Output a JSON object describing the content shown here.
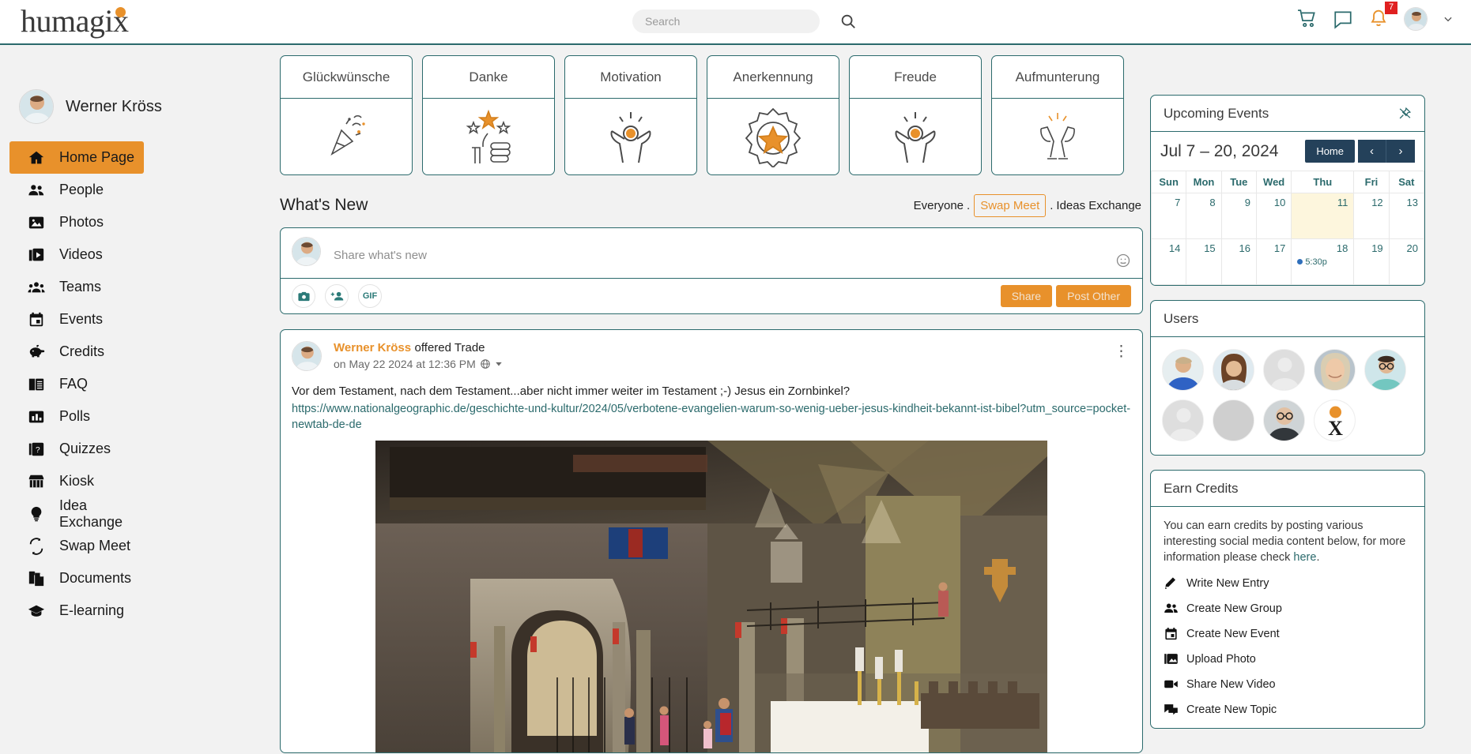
{
  "header": {
    "logo": "humagix",
    "search": {
      "placeholder": "Search",
      "value": ""
    },
    "icons": {
      "cart": "shopping-cart-icon",
      "chat": "chat-bubble-icon",
      "bell": "notification-bell-icon",
      "bell_badge": "7",
      "avatar": "user-avatar",
      "chevron": "chevron-down-icon"
    }
  },
  "sidebar": {
    "user": {
      "name": "Werner Kröss"
    },
    "items": [
      {
        "label": "Home Page",
        "icon": "home-icon",
        "active": true
      },
      {
        "label": "People",
        "icon": "people-icon",
        "active": false
      },
      {
        "label": "Photos",
        "icon": "photo-icon",
        "active": false
      },
      {
        "label": "Videos",
        "icon": "video-icon",
        "active": false
      },
      {
        "label": "Teams",
        "icon": "teams-icon",
        "active": false
      },
      {
        "label": "Events",
        "icon": "calendar-icon",
        "active": false
      },
      {
        "label": "Credits",
        "icon": "piggy-bank-icon",
        "active": false
      },
      {
        "label": "FAQ",
        "icon": "book-icon",
        "active": false
      },
      {
        "label": "Polls",
        "icon": "poll-chart-icon",
        "active": false
      },
      {
        "label": "Quizzes",
        "icon": "quiz-question-icon",
        "active": false
      },
      {
        "label": "Kiosk",
        "icon": "storefront-icon",
        "active": false
      },
      {
        "label": "Idea Exchange",
        "icon": "lightbulb-icon",
        "active": false
      },
      {
        "label": "Swap Meet",
        "icon": "swap-arrows-icon",
        "active": false
      },
      {
        "label": "Documents",
        "icon": "documents-icon",
        "active": false
      },
      {
        "label": "E-learning",
        "icon": "graduation-cap-icon",
        "active": false
      }
    ]
  },
  "recognition_cards": [
    {
      "title": "Glückwünsche",
      "icon": "party-popper-icon"
    },
    {
      "title": "Danke",
      "icon": "thumbs-up-stars-icon"
    },
    {
      "title": "Motivation",
      "icon": "raised-hands-icon"
    },
    {
      "title": "Anerkennung",
      "icon": "award-badge-star-icon"
    },
    {
      "title": "Freude",
      "icon": "celebrate-person-icon"
    },
    {
      "title": "Aufmunterung",
      "icon": "champagne-toast-icon"
    }
  ],
  "feed": {
    "title": "What's New",
    "filters": [
      {
        "label": "Everyone",
        "active": false
      },
      {
        "label": "Swap Meet",
        "active": true
      },
      {
        "label": "Ideas Exchange",
        "active": false
      }
    ],
    "separator": ".",
    "composer": {
      "placeholder": "Share what's new",
      "value": "",
      "tools": [
        "camera-icon",
        "tag-person-icon",
        "gif-icon"
      ],
      "emoji_icon": "emoji-smiley-icon",
      "share_label": "Share",
      "post_other_label": "Post Other"
    },
    "post": {
      "author": "Werner Kröss",
      "action": "offered Trade",
      "date": "on May 22 2024 at 12:36 PM",
      "visibility_icon": "globe-icon",
      "visibility_chevron": "chevron-down-icon",
      "menu_icon": "vertical-ellipsis-icon",
      "text": "Vor dem Testament, nach dem Testament...aber nicht immer weiter im Testament ;-) Jesus ein Zornbinkel?",
      "link": "https://www.nationalgeographic.de/geschichte-und-kultur/2024/05/verbotene-evangelien-warum-so-wenig-ueber-jesus-kindheit-bekannt-ist-bibel?utm_source=pocket-newtab-de-de",
      "image_alt": "church-interior-photo"
    }
  },
  "events_panel": {
    "title": "Upcoming Events",
    "pin_icon": "unpin-icon",
    "range": "Jul 7 – 20, 2024",
    "home_label": "Home",
    "prev_label": "‹",
    "next_label": "›",
    "weekdays": [
      "Sun",
      "Mon",
      "Tue",
      "Wed",
      "Thu",
      "Fri",
      "Sat"
    ],
    "weeks": [
      [
        {
          "day": "7",
          "today": false,
          "event": null
        },
        {
          "day": "8",
          "today": false,
          "event": null
        },
        {
          "day": "9",
          "today": false,
          "event": null
        },
        {
          "day": "10",
          "today": false,
          "event": null
        },
        {
          "day": "11",
          "today": true,
          "event": null
        },
        {
          "day": "12",
          "today": false,
          "event": null
        },
        {
          "day": "13",
          "today": false,
          "event": null
        }
      ],
      [
        {
          "day": "14",
          "today": false,
          "event": null
        },
        {
          "day": "15",
          "today": false,
          "event": null
        },
        {
          "day": "16",
          "today": false,
          "event": null
        },
        {
          "day": "17",
          "today": false,
          "event": null
        },
        {
          "day": "18",
          "today": false,
          "event": "5:30p"
        },
        {
          "day": "19",
          "today": false,
          "event": null
        },
        {
          "day": "20",
          "today": false,
          "event": null
        }
      ]
    ]
  },
  "users_panel": {
    "title": "Users",
    "avatars": [
      {
        "name": "user-avatar-1",
        "type": "photo-man-blue"
      },
      {
        "name": "user-avatar-2",
        "type": "photo-woman-brown"
      },
      {
        "name": "user-avatar-3",
        "type": "placeholder"
      },
      {
        "name": "user-avatar-4",
        "type": "photo-woman-blonde"
      },
      {
        "name": "user-avatar-5",
        "type": "photo-person-glasses"
      },
      {
        "name": "user-avatar-6",
        "type": "placeholder"
      },
      {
        "name": "user-avatar-7",
        "type": "blank-gray"
      },
      {
        "name": "user-avatar-8",
        "type": "photo-man-bald"
      },
      {
        "name": "user-avatar-9",
        "type": "logo-x-orange"
      }
    ]
  },
  "credits_panel": {
    "title": "Earn Credits",
    "description_before": "You can earn credits by posting various interesting social media content below, for more information please check ",
    "link_label": "here",
    "description_after": ".",
    "items": [
      {
        "label": "Write New Entry",
        "icon": "pencil-icon"
      },
      {
        "label": "Create New Group",
        "icon": "group-people-icon"
      },
      {
        "label": "Create New Event",
        "icon": "calendar-icon"
      },
      {
        "label": "Upload Photo",
        "icon": "photo-upload-icon"
      },
      {
        "label": "Share New Video",
        "icon": "video-camera-icon"
      },
      {
        "label": "Create New Topic",
        "icon": "chat-topic-icon"
      }
    ]
  },
  "colors": {
    "accent_orange": "#e8912b",
    "teal_border": "#2b6a6c",
    "navy_button": "#24415a",
    "badge_red": "#e02020",
    "page_bg": "#f2f2f2",
    "today_yellow": "#fdf6dd"
  }
}
